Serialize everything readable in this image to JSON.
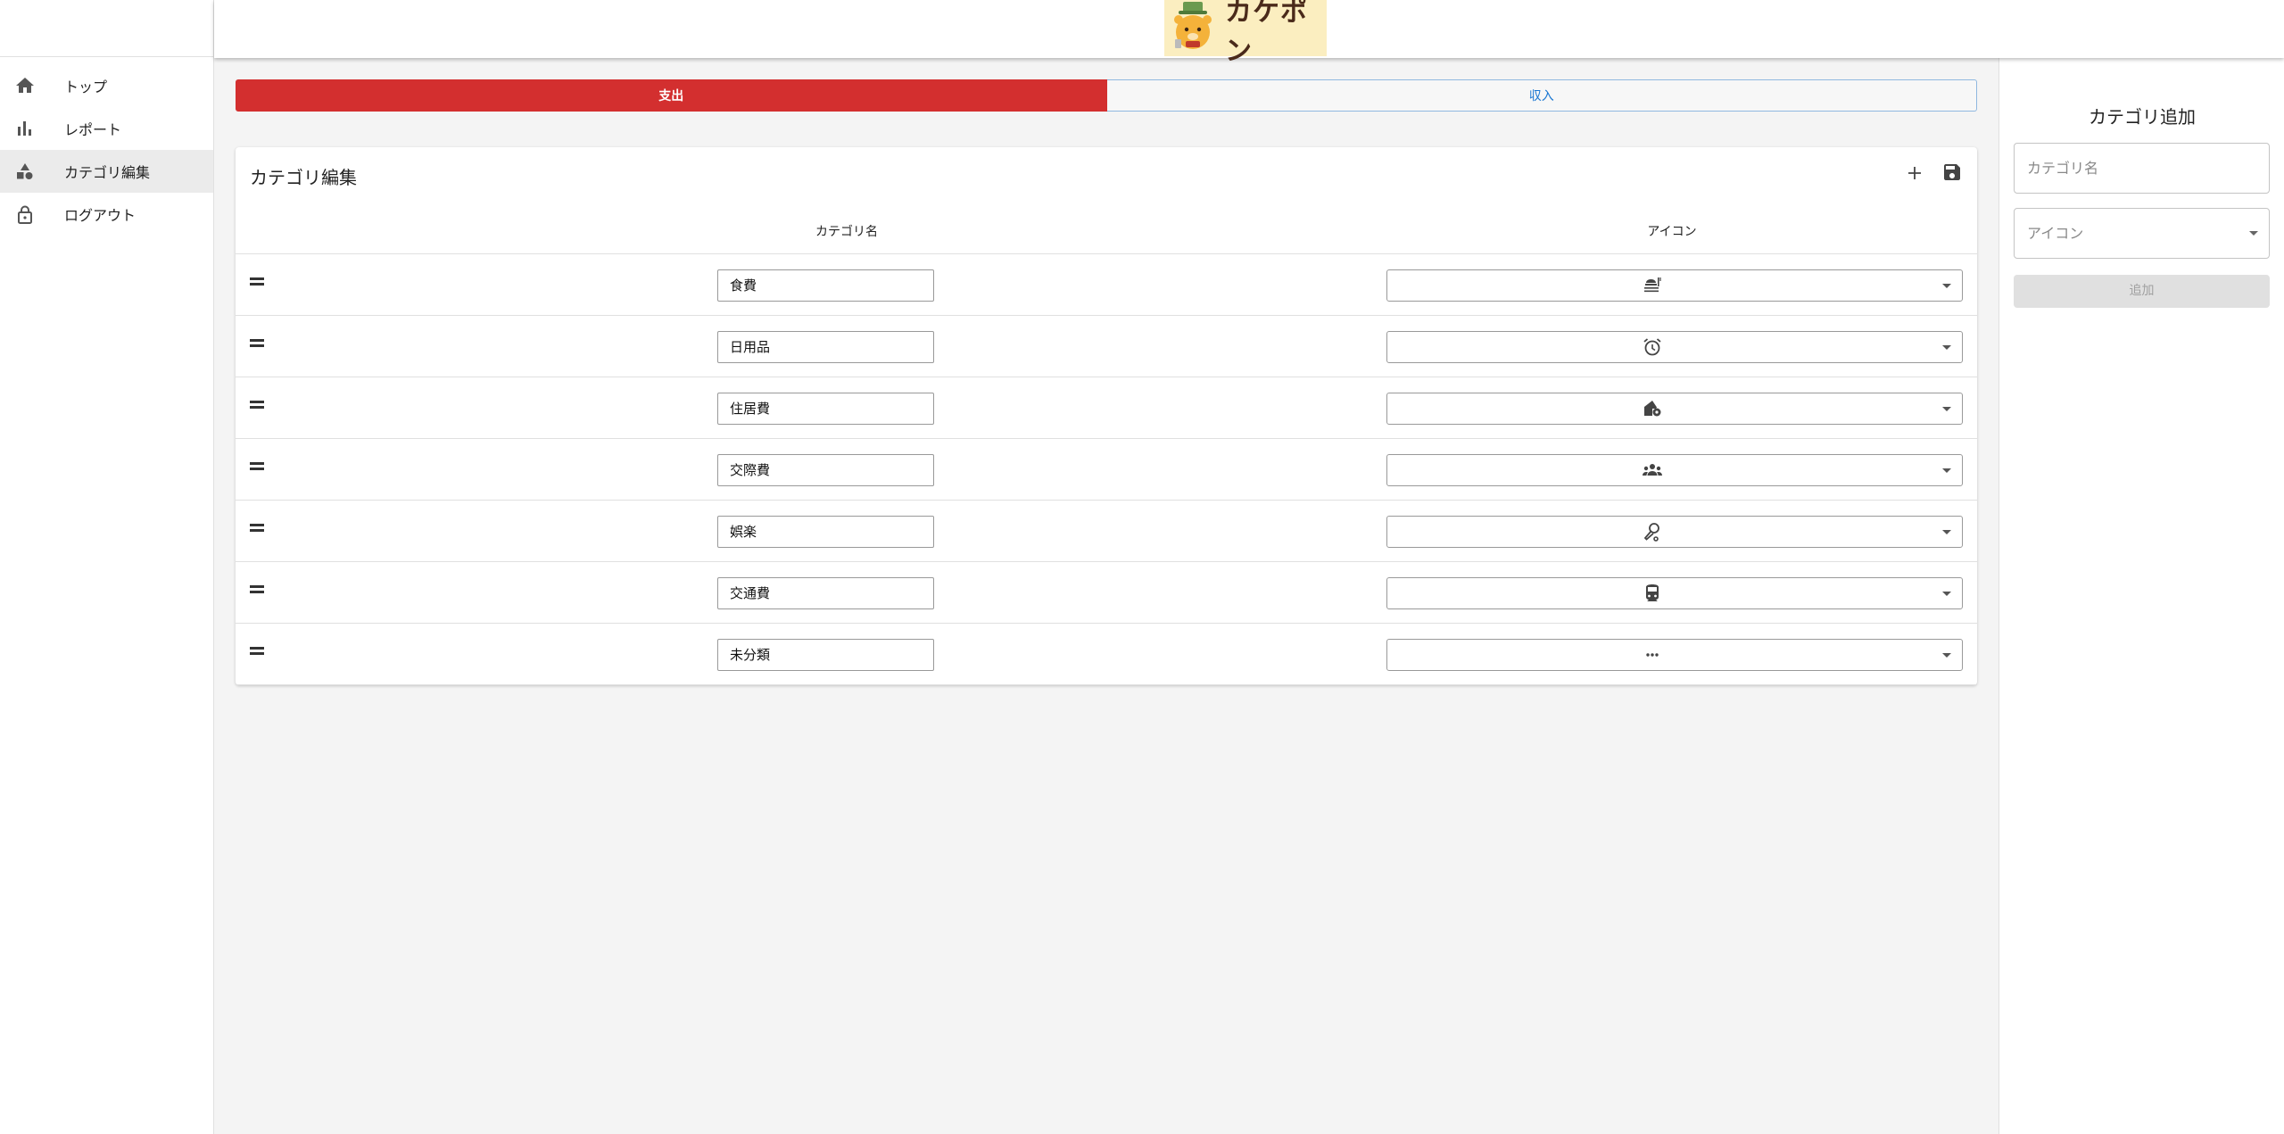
{
  "header": {
    "logo_text": "カケポン"
  },
  "sidebar": {
    "items": [
      {
        "label": "トップ",
        "icon": "home-icon"
      },
      {
        "label": "レポート",
        "icon": "bar-chart-icon"
      },
      {
        "label": "カテゴリ編集",
        "icon": "category-icon",
        "active": true
      },
      {
        "label": "ログアウト",
        "icon": "lock-icon"
      }
    ]
  },
  "tabs": {
    "expense": "支出",
    "income": "収入"
  },
  "editor": {
    "title": "カテゴリ編集",
    "col_name": "カテゴリ名",
    "col_icon": "アイコン",
    "rows": [
      {
        "name": "食費",
        "icon": "dining-icon"
      },
      {
        "name": "日用品",
        "icon": "alarm-clock-icon"
      },
      {
        "name": "住居費",
        "icon": "house-icon"
      },
      {
        "name": "交際費",
        "icon": "groups-icon"
      },
      {
        "name": "娯楽",
        "icon": "microphone-icon"
      },
      {
        "name": "交通費",
        "icon": "train-icon"
      },
      {
        "name": "未分類",
        "icon": "more-horiz-icon"
      }
    ]
  },
  "add_panel": {
    "title": "カテゴリ追加",
    "name_placeholder": "カテゴリ名",
    "icon_placeholder": "アイコン",
    "add_button": "追加"
  },
  "colors": {
    "expense_tab": "#d32f2f",
    "income_text": "#1976d2"
  }
}
